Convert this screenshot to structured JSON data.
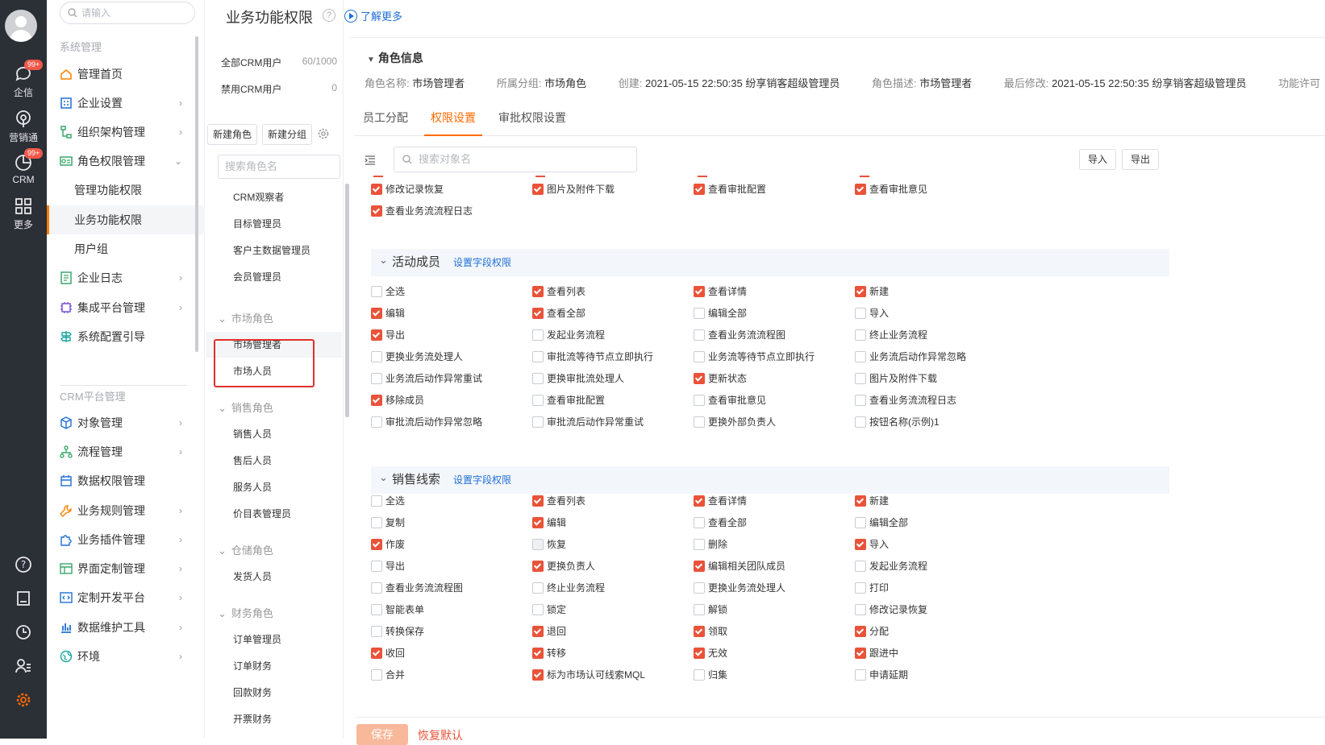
{
  "rail": {
    "items": [
      {
        "label": "企信",
        "badge": "99+"
      },
      {
        "label": "营销通"
      },
      {
        "label": "CRM",
        "badge": "99+"
      },
      {
        "label": "更多"
      }
    ]
  },
  "sidebar": {
    "search_placeholder": "请输入",
    "group1": "系统管理",
    "items1": [
      {
        "label": "管理首页"
      },
      {
        "label": "企业设置"
      },
      {
        "label": "组织架构管理"
      },
      {
        "label": "角色权限管理"
      },
      {
        "label": "管理功能权限"
      },
      {
        "label": "业务功能权限"
      },
      {
        "label": "用户组"
      },
      {
        "label": "企业日志"
      },
      {
        "label": "集成平台管理"
      },
      {
        "label": "系统配置引导"
      }
    ],
    "group2": "CRM平台管理",
    "items2": [
      {
        "label": "对象管理"
      },
      {
        "label": "流程管理"
      },
      {
        "label": "数据权限管理"
      },
      {
        "label": "业务规则管理"
      },
      {
        "label": "业务插件管理"
      },
      {
        "label": "界面定制管理"
      },
      {
        "label": "定制开发平台"
      },
      {
        "label": "数据维护工具"
      },
      {
        "label": "环境"
      }
    ]
  },
  "page": {
    "title": "业务功能权限",
    "learn_more": "了解更多"
  },
  "roles": {
    "all_users": "全部CRM用户",
    "all_users_count": "60/1000",
    "disabled_users": "禁用CRM用户",
    "disabled_count": "0",
    "new_role": "新建角色",
    "new_group": "新建分组",
    "search_placeholder": "搜索角色名",
    "list": [
      "CRM观察者",
      "目标管理员",
      "客户主数据管理员",
      "会员管理员"
    ],
    "group_market": "市场角色",
    "market": [
      "市场管理者",
      "市场人员"
    ],
    "group_sales": "销售角色",
    "sales": [
      "销售人员",
      "售后人员",
      "服务人员",
      "价目表管理员"
    ],
    "group_warehouse": "仓储角色",
    "warehouse": [
      "发货人员"
    ],
    "group_finance": "财务角色",
    "finance": [
      "订单管理员",
      "订单财务",
      "回款财务",
      "开票财务"
    ]
  },
  "role_info": {
    "title": "角色信息",
    "name_k": "角色名称:",
    "name_v": "市场管理者",
    "group_k": "所属分组:",
    "group_v": "市场角色",
    "created_k": "创建:",
    "created_v": "2021-05-15 22:50:35 纷享销客超级管理员",
    "desc_k": "角色描述:",
    "desc_v": "市场管理者",
    "modified_k": "最后修改:",
    "modified_v": "2021-05-15 22:50:35 纷享销客超级管理员",
    "license_k": "功能许可"
  },
  "tabs": [
    "员工分配",
    "权限设置",
    "审批权限设置"
  ],
  "object_search_placeholder": "搜索对象名",
  "import": "导入",
  "export": "导出",
  "top_perms": [
    {
      "label": "修改记录恢复",
      "on": true
    },
    {
      "label": "图片及附件下载",
      "on": true
    },
    {
      "label": "查看审批配置",
      "on": true
    },
    {
      "label": "查看审批意见",
      "on": true
    },
    {
      "label": "查看业务流流程日志",
      "on": true
    }
  ],
  "sections": [
    {
      "title": "活动成员",
      "link": "设置字段权限",
      "perms": [
        {
          "label": "全选",
          "on": false
        },
        {
          "label": "查看列表",
          "on": true
        },
        {
          "label": "查看详情",
          "on": true
        },
        {
          "label": "新建",
          "on": true
        },
        {
          "label": "编辑",
          "on": true
        },
        {
          "label": "查看全部",
          "on": true
        },
        {
          "label": "编辑全部",
          "on": false
        },
        {
          "label": "导入",
          "on": false
        },
        {
          "label": "导出",
          "on": true
        },
        {
          "label": "发起业务流程",
          "on": false
        },
        {
          "label": "查看业务流流程图",
          "on": false
        },
        {
          "label": "终止业务流程",
          "on": false
        },
        {
          "label": "更换业务流处理人",
          "on": false
        },
        {
          "label": "审批流等待节点立即执行",
          "on": false
        },
        {
          "label": "业务流等待节点立即执行",
          "on": false
        },
        {
          "label": "业务流后动作异常忽略",
          "on": false
        },
        {
          "label": "业务流后动作异常重试",
          "on": false
        },
        {
          "label": "更换审批流处理人",
          "on": false
        },
        {
          "label": "更新状态",
          "on": true
        },
        {
          "label": "图片及附件下载",
          "on": false
        },
        {
          "label": "移除成员",
          "on": true
        },
        {
          "label": "查看审批配置",
          "on": false
        },
        {
          "label": "查看审批意见",
          "on": false
        },
        {
          "label": "查看业务流流程日志",
          "on": false
        },
        {
          "label": "审批流后动作异常忽略",
          "on": false
        },
        {
          "label": "审批流后动作异常重试",
          "on": false
        },
        {
          "label": "更换外部负责人",
          "on": false
        },
        {
          "label": "按钮名称(示例)1",
          "on": false
        }
      ]
    },
    {
      "title": "销售线索",
      "link": "设置字段权限",
      "perms": [
        {
          "label": "全选",
          "on": false
        },
        {
          "label": "查看列表",
          "on": true
        },
        {
          "label": "查看详情",
          "on": true
        },
        {
          "label": "新建",
          "on": true
        },
        {
          "label": "复制",
          "on": false
        },
        {
          "label": "编辑",
          "on": true
        },
        {
          "label": "查看全部",
          "on": false
        },
        {
          "label": "编辑全部",
          "on": false
        },
        {
          "label": "作废",
          "on": true
        },
        {
          "label": "恢复",
          "on": false,
          "dis": true
        },
        {
          "label": "删除",
          "on": false
        },
        {
          "label": "导入",
          "on": true
        },
        {
          "label": "导出",
          "on": false
        },
        {
          "label": "更换负责人",
          "on": true
        },
        {
          "label": "编辑相关团队成员",
          "on": true
        },
        {
          "label": "发起业务流程",
          "on": false
        },
        {
          "label": "查看业务流流程图",
          "on": false
        },
        {
          "label": "终止业务流程",
          "on": false
        },
        {
          "label": "更换业务流处理人",
          "on": false
        },
        {
          "label": "打印",
          "on": false
        },
        {
          "label": "智能表单",
          "on": false
        },
        {
          "label": "锁定",
          "on": false
        },
        {
          "label": "解锁",
          "on": false
        },
        {
          "label": "修改记录恢复",
          "on": false
        },
        {
          "label": "转换保存",
          "on": false
        },
        {
          "label": "退回",
          "on": true
        },
        {
          "label": "领取",
          "on": true
        },
        {
          "label": "分配",
          "on": true
        },
        {
          "label": "收回",
          "on": true
        },
        {
          "label": "转移",
          "on": true
        },
        {
          "label": "无效",
          "on": true
        },
        {
          "label": "跟进中",
          "on": true
        },
        {
          "label": "合并",
          "on": false
        },
        {
          "label": "标为市场认可线索MQL",
          "on": true
        },
        {
          "label": "归集",
          "on": false
        },
        {
          "label": "申请延期",
          "on": false
        }
      ]
    }
  ],
  "footer": {
    "save": "保存",
    "reset": "恢复默认"
  },
  "colors": {
    "accent": "#ff6a00",
    "check": "#e9533a",
    "link": "#1f6fd6",
    "rail": "#2b2f36"
  }
}
